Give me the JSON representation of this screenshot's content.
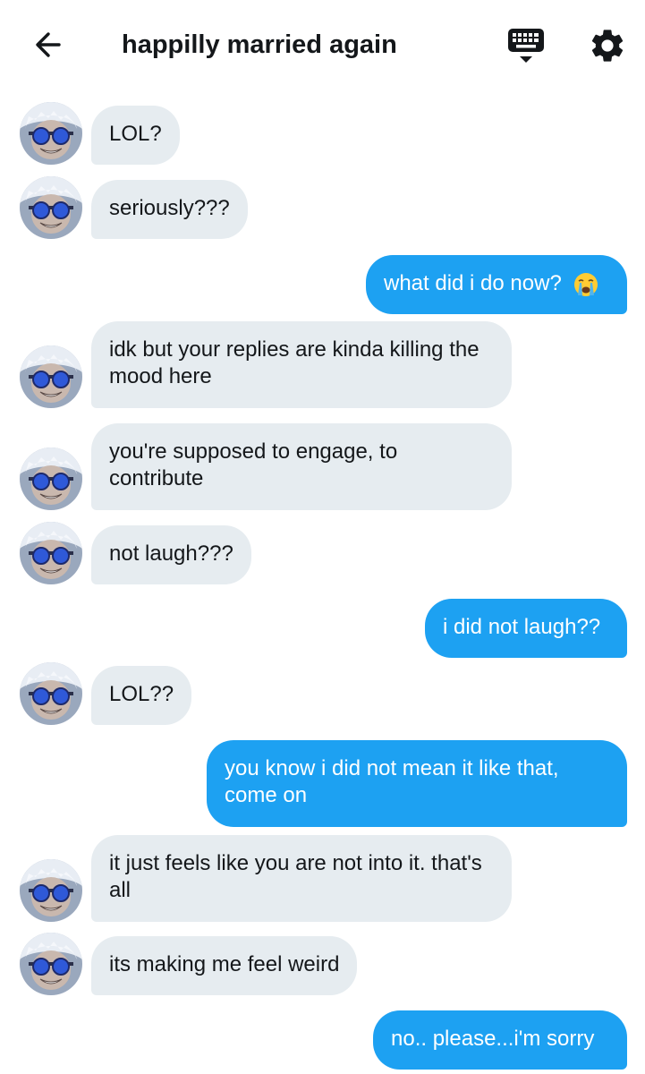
{
  "header": {
    "title": "happilly married again",
    "back_icon": "arrow-left-icon",
    "keyboard_icon": "keyboard-icon",
    "settings_icon": "gear-icon"
  },
  "colors": {
    "outgoing_bubble": "#1da1f2",
    "incoming_bubble": "#e6ecf0",
    "text": "#14171a"
  },
  "messages": [
    {
      "from": "them",
      "text": "LOL?"
    },
    {
      "from": "them",
      "text": "seriously???"
    },
    {
      "from": "me",
      "text": "what did i do now?",
      "emoji": "loudly-crying-face-emoji"
    },
    {
      "from": "them",
      "text": "idk but your replies are kinda killing the mood here"
    },
    {
      "from": "them",
      "text": "you're supposed to engage, to contribute"
    },
    {
      "from": "them",
      "text": "not laugh???"
    },
    {
      "from": "me",
      "text": "i did not laugh??"
    },
    {
      "from": "them",
      "text": "LOL??"
    },
    {
      "from": "me",
      "text": "you know i did not mean it like that, come on"
    },
    {
      "from": "them",
      "text": "it just feels like you are not into it. that's all"
    },
    {
      "from": "them",
      "text": "its making me feel weird"
    },
    {
      "from": "me",
      "text": "no.. please...i'm sorry"
    }
  ]
}
